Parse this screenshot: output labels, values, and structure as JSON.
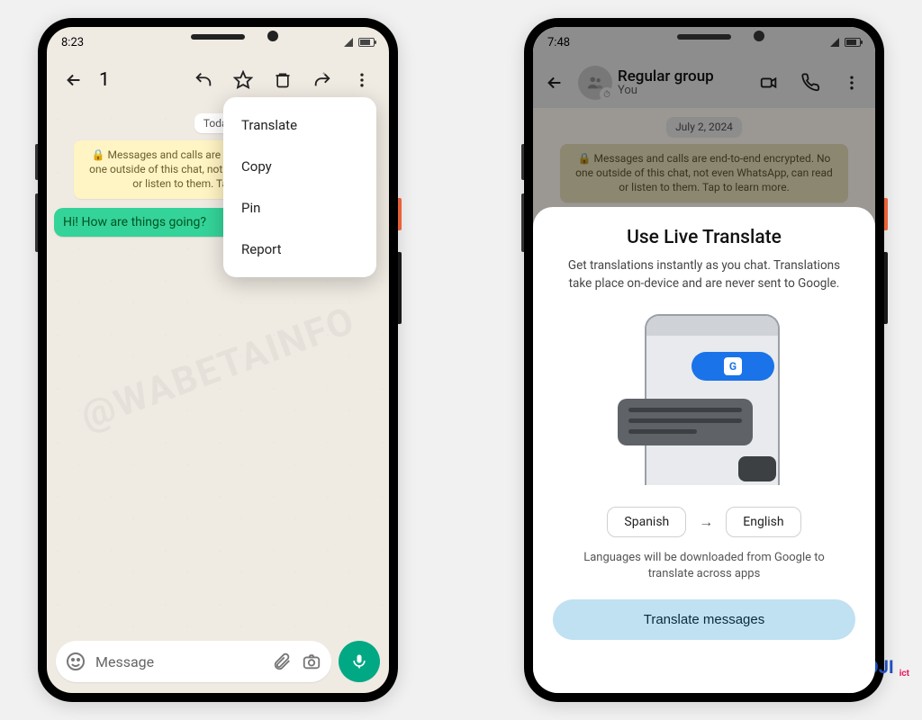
{
  "watermark": "@WABETAINFO",
  "brand": {
    "text": "TEKNOLOJI",
    "suffix": "ict"
  },
  "left": {
    "status_time": "8:23",
    "selected_count": "1",
    "date_chip": "Today",
    "e2e_text": "🔒 Messages and calls are end-to-end encrypted. No one outside of this chat, not even WhatsApp, can read or listen to them. Tap to learn more.",
    "message": "Hi! How are things going?",
    "composer_placeholder": "Message",
    "menu": {
      "translate": "Translate",
      "copy": "Copy",
      "pin": "Pin",
      "report": "Report"
    }
  },
  "right": {
    "status_time": "7:48",
    "group_name": "Regular group",
    "group_sub": "You",
    "date_chip": "July 2, 2024",
    "e2e_text": "🔒 Messages and calls are end-to-end encrypted. No one outside of this chat, not even WhatsApp, can read or listen to them. Tap to learn more.",
    "sheet": {
      "title": "Use Live Translate",
      "desc": "Get translations instantly as you chat. Translations take place on-device and are never sent to Google.",
      "lang_from": "Spanish",
      "lang_to": "English",
      "note": "Languages will be downloaded from Google to translate across apps",
      "cta": "Translate messages"
    }
  }
}
